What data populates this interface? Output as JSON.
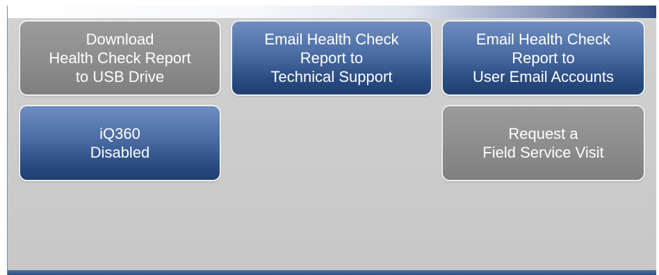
{
  "buttons": {
    "download_report": {
      "label": "Download\nHealth Check Report\nto USB Drive",
      "state": "disabled"
    },
    "email_tech_support": {
      "label": "Email Health Check\nReport to\nTechnical Support",
      "state": "enabled"
    },
    "email_user_accounts": {
      "label": "Email Health Check\nReport to\nUser Email Accounts",
      "state": "enabled"
    },
    "iq360": {
      "label": "iQ360\nDisabled",
      "state": "enabled"
    },
    "field_service": {
      "label": "Request a\nField Service Visit",
      "state": "disabled"
    }
  },
  "colors": {
    "enabled_button": "#294b80",
    "disabled_button": "#8e8e8e",
    "background": "#cccccc"
  }
}
